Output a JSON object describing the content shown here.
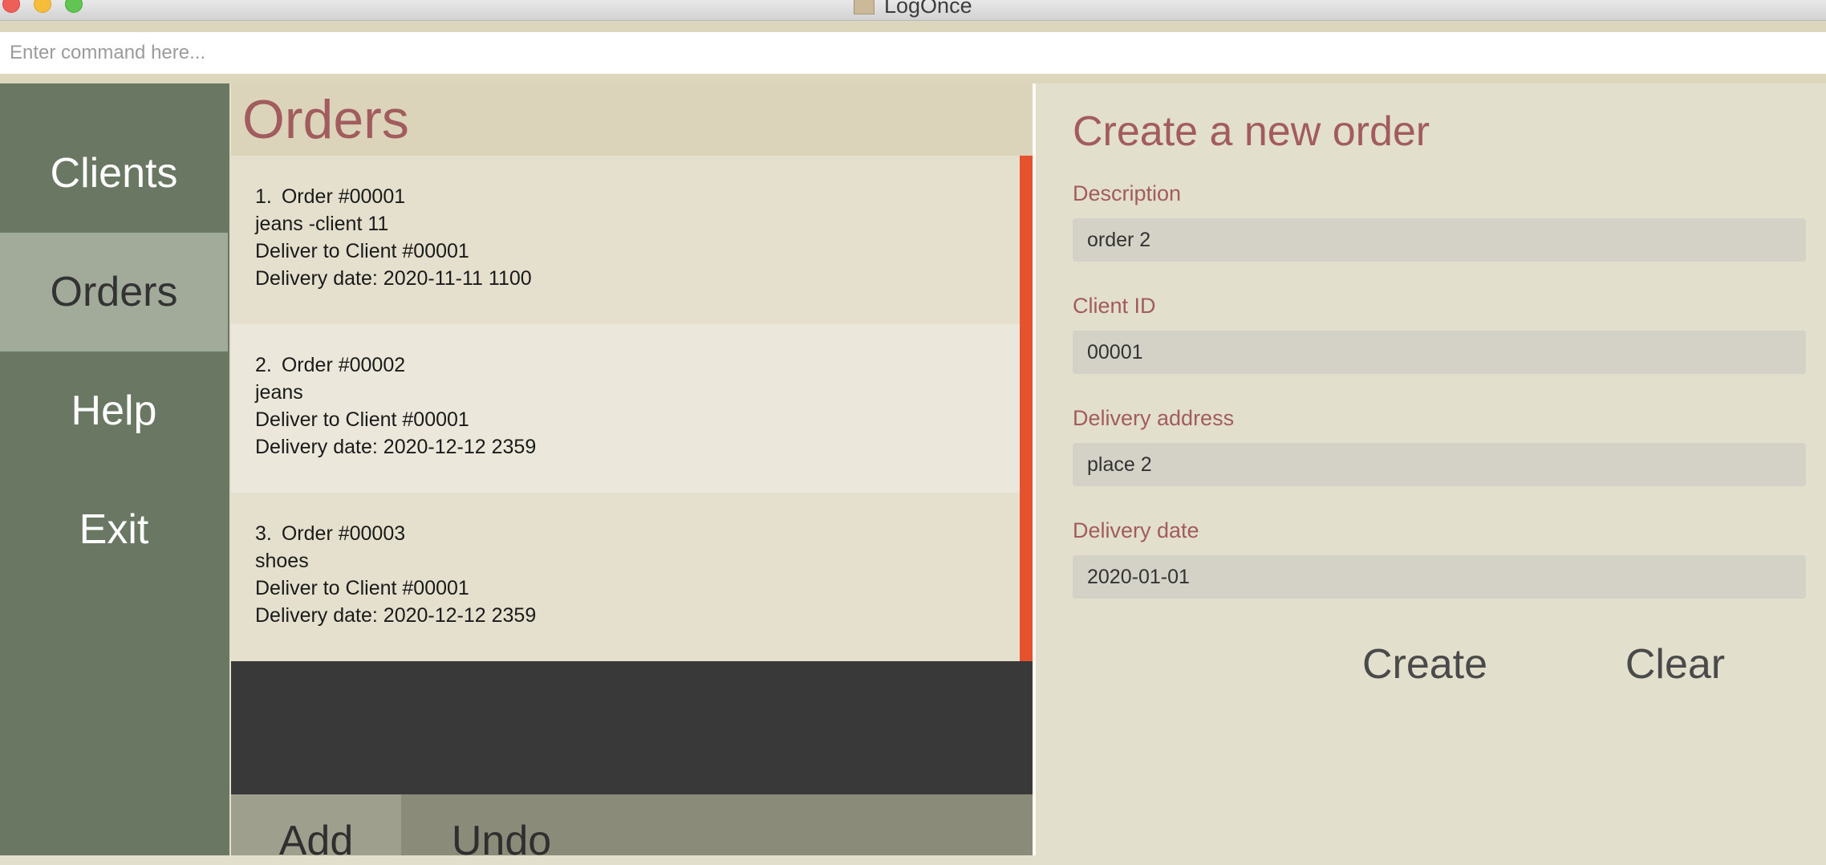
{
  "window": {
    "title": "LogOnce"
  },
  "command": {
    "placeholder": "Enter command here...",
    "value": ""
  },
  "sidebar": {
    "items": [
      {
        "label": "Clients",
        "active": false
      },
      {
        "label": "Orders",
        "active": true
      },
      {
        "label": "Help",
        "active": false
      },
      {
        "label": "Exit",
        "active": false
      }
    ]
  },
  "orders": {
    "title": "Orders",
    "list": [
      {
        "index": "1.",
        "order_id": "Order #00001",
        "description": "jeans -client 11",
        "deliver_to": "Deliver to Client #00001",
        "delivery_date": "Delivery date: 2020-11-11 1100"
      },
      {
        "index": "2.",
        "order_id": "Order #00002",
        "description": "jeans",
        "deliver_to": "Deliver to Client #00001",
        "delivery_date": "Delivery date: 2020-12-12 2359"
      },
      {
        "index": "3.",
        "order_id": "Order #00003",
        "description": "shoes",
        "deliver_to": "Deliver to Client #00001",
        "delivery_date": "Delivery date: 2020-12-12 2359"
      }
    ],
    "buttons": {
      "add": "Add",
      "undo": "Undo"
    }
  },
  "form": {
    "title": "Create a new order",
    "fields": {
      "description": {
        "label": "Description",
        "value": "order 2"
      },
      "client_id": {
        "label": "Client ID",
        "value": "00001"
      },
      "delivery_address": {
        "label": "Delivery address",
        "value": "place 2"
      },
      "delivery_date": {
        "label": "Delivery date",
        "value": "2020-01-01"
      }
    },
    "buttons": {
      "create": "Create",
      "clear": "Clear"
    }
  },
  "colors": {
    "accent_title": "#a25c5e",
    "sidebar_bg": "#697763",
    "sidebar_active": "#a2ab9a",
    "scrollbar": "#e4522e",
    "panel_bg": "#e2dfcc"
  }
}
